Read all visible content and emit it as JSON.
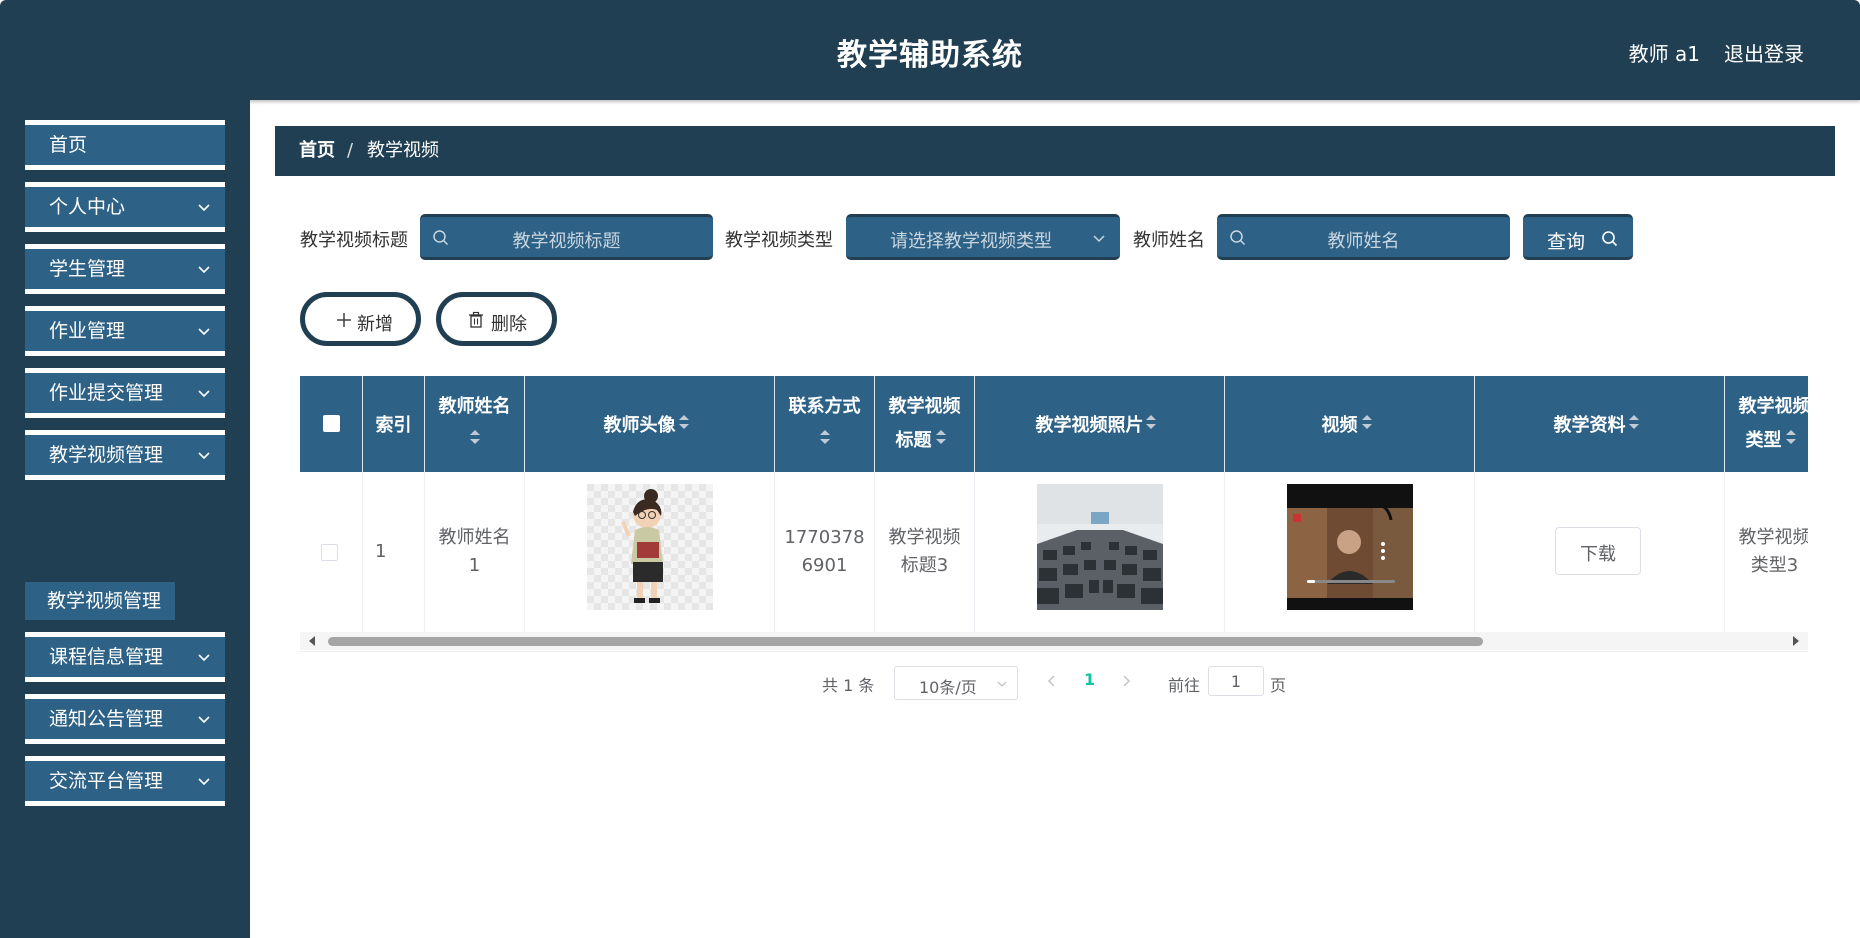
{
  "header": {
    "title": "教学辅助系统",
    "user": "教师 a1",
    "logout": "退出登录"
  },
  "sidebar": {
    "items": [
      {
        "label": "首页",
        "has_arrow": false
      },
      {
        "label": "个人中心",
        "has_arrow": true
      },
      {
        "label": "学生管理",
        "has_arrow": true
      },
      {
        "label": "作业管理",
        "has_arrow": true
      },
      {
        "label": "作业提交管理",
        "has_arrow": true
      },
      {
        "label": "教学视频管理",
        "has_arrow": true,
        "expanded": true
      },
      {
        "label": "课程信息管理",
        "has_arrow": true
      },
      {
        "label": "通知公告管理",
        "has_arrow": true
      },
      {
        "label": "交流平台管理",
        "has_arrow": true
      }
    ],
    "submenu": {
      "label": "教学视频管理"
    }
  },
  "breadcrumb": {
    "home": "首页",
    "separator": "/",
    "current": "教学视频"
  },
  "search": {
    "title_label": "教学视频标题",
    "title_placeholder": "教学视频标题",
    "type_label": "教学视频类型",
    "type_placeholder": "请选择教学视频类型",
    "teacher_label": "教师姓名",
    "teacher_placeholder": "教师姓名",
    "query_button": "查询"
  },
  "actions": {
    "add": "新增",
    "delete": "删除"
  },
  "table": {
    "columns": {
      "index": "索引",
      "teacher_name_1": "教师姓名",
      "avatar": "教师头像",
      "contact": "联系方式",
      "title_1": "教学视频",
      "title_2": "标题",
      "photo": "教学视频照片",
      "video": "视频",
      "material": "教学资料",
      "type_1": "教学视频",
      "type_2": "类型"
    },
    "row": {
      "index": "1",
      "teacher_name_1": "教师姓名",
      "teacher_name_2": "1",
      "contact_1": "1770378",
      "contact_2": "6901",
      "title_1": "教学视频",
      "title_2": "标题3",
      "download": "下载",
      "type_1": "教学视频",
      "type_2": "类型3"
    }
  },
  "pagination": {
    "total": "共 1 条",
    "page_size": "10条/页",
    "current_page": "1",
    "goto_label": "前往",
    "goto_value": "1",
    "page_suffix": "页"
  },
  "colors": {
    "dark": "#213f52",
    "primary": "#2d6186",
    "active_page": "#13c2a0"
  }
}
